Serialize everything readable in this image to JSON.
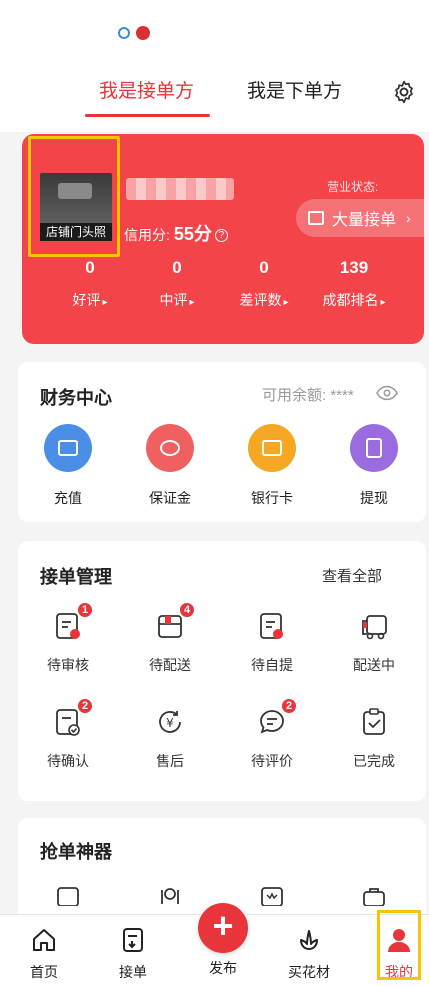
{
  "header": {
    "tabs": [
      {
        "label": "我是接单方",
        "active": true
      },
      {
        "label": "我是下单方",
        "active": false
      }
    ]
  },
  "shop": {
    "photo_caption": "店铺门头照",
    "credit_label": "信用分:",
    "credit_score": "55分",
    "business_status_label": "营业状态:",
    "business_status": "大量接单"
  },
  "stats": [
    {
      "value": "0",
      "label": "好评"
    },
    {
      "value": "0",
      "label": "中评"
    },
    {
      "value": "0",
      "label": "差评数"
    },
    {
      "value": "139",
      "label": "成都排名"
    }
  ],
  "finance": {
    "title": "财务中心",
    "balance_label": "可用余额: ****",
    "items": [
      {
        "label": "充值",
        "icon": "wallet-icon",
        "color": "#4a8ee8"
      },
      {
        "label": "保证金",
        "icon": "deposit-icon",
        "color": "#f06060"
      },
      {
        "label": "银行卡",
        "icon": "bank-card-icon",
        "color": "#f5a623"
      },
      {
        "label": "提现",
        "icon": "withdraw-icon",
        "color": "#9b6be0"
      }
    ]
  },
  "orders": {
    "title": "接单管理",
    "view_all": "查看全部",
    "items": [
      {
        "label": "待审核",
        "badge": "1"
      },
      {
        "label": "待配送",
        "badge": "4"
      },
      {
        "label": "待自提",
        "badge": ""
      },
      {
        "label": "配送中",
        "badge": ""
      },
      {
        "label": "待确认",
        "badge": "2"
      },
      {
        "label": "售后",
        "badge": ""
      },
      {
        "label": "待评价",
        "badge": "2"
      },
      {
        "label": "已完成",
        "badge": ""
      }
    ]
  },
  "grab": {
    "title": "抢单神器"
  },
  "tabbar": {
    "items": [
      {
        "label": "首页"
      },
      {
        "label": "接单"
      },
      {
        "label": "发布"
      },
      {
        "label": "买花材"
      },
      {
        "label": "我的"
      }
    ]
  },
  "colors": {
    "brand_red": "#e8343b",
    "card_red": "#f24449",
    "highlight": "#f7c600"
  }
}
